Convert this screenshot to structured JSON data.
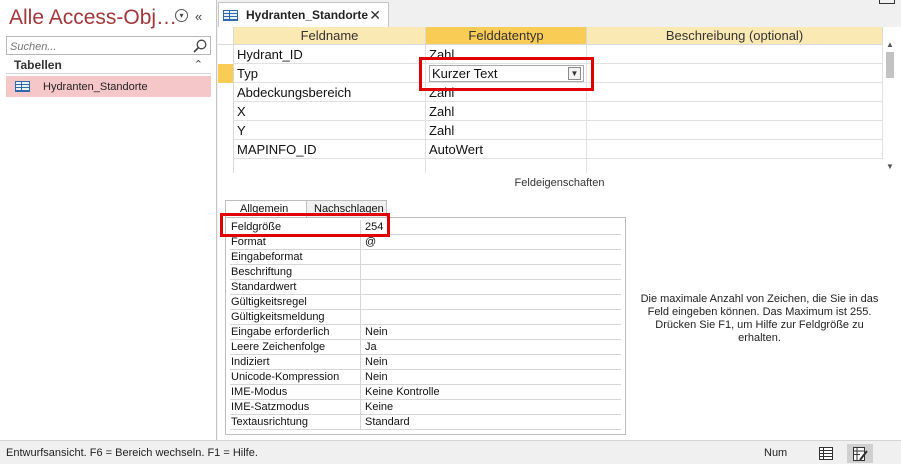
{
  "nav": {
    "title": "Alle Access-Obj…",
    "search_placeholder": "Suchen...",
    "group": "Tabellen",
    "items": [
      {
        "label": "Hydranten_Standorte",
        "selected": true
      }
    ]
  },
  "document_tab": {
    "label": "Hydranten_Standorte"
  },
  "grid": {
    "headers": [
      "Feldname",
      "Felddatentyp",
      "Beschreibung (optional)"
    ],
    "rows": [
      {
        "field": "Hydrant_ID",
        "type": "Zahl",
        "description": ""
      },
      {
        "field": "Typ",
        "type": "Kurzer Text",
        "description": ""
      },
      {
        "field": "Abdeckungsbereich",
        "type": "Zahl",
        "description": ""
      },
      {
        "field": "X",
        "type": "Zahl",
        "description": ""
      },
      {
        "field": "Y",
        "type": "Zahl",
        "description": ""
      },
      {
        "field": "MAPINFO_ID",
        "type": "AutoWert",
        "description": ""
      }
    ],
    "selected_row": 1
  },
  "field_properties": {
    "section_label": "Feldeigenschaften",
    "tabs": [
      "Allgemein",
      "Nachschlagen"
    ],
    "active_tab": "Allgemein",
    "rows": [
      {
        "name": "Feldgröße",
        "value": "254"
      },
      {
        "name": "Format",
        "value": "@"
      },
      {
        "name": "Eingabeformat",
        "value": ""
      },
      {
        "name": "Beschriftung",
        "value": ""
      },
      {
        "name": "Standardwert",
        "value": ""
      },
      {
        "name": "Gültigkeitsregel",
        "value": ""
      },
      {
        "name": "Gültigkeitsmeldung",
        "value": ""
      },
      {
        "name": "Eingabe erforderlich",
        "value": "Nein"
      },
      {
        "name": "Leere Zeichenfolge",
        "value": "Ja"
      },
      {
        "name": "Indiziert",
        "value": "Nein"
      },
      {
        "name": "Unicode-Kompression",
        "value": "Nein"
      },
      {
        "name": "IME-Modus",
        "value": "Keine Kontrolle"
      },
      {
        "name": "IME-Satzmodus",
        "value": "Keine"
      },
      {
        "name": "Textausrichtung",
        "value": "Standard"
      }
    ],
    "help_text": "Die maximale Anzahl von Zeichen, die Sie in das Feld eingeben können. Das Maximum ist 255. Drücken Sie F1, um Hilfe zur Feldgröße zu erhalten."
  },
  "status_bar": {
    "message": "Entwurfsansicht. F6 = Bereich wechseln. F1 = Hilfe.",
    "num_lock": "Num"
  },
  "colors": {
    "accent_red": "#a4373a",
    "highlight_red": "#e00000",
    "header_yellow": "#fbe9b3",
    "active_yellow": "#f8cc55",
    "nav_selected": "#f6c7c8"
  }
}
